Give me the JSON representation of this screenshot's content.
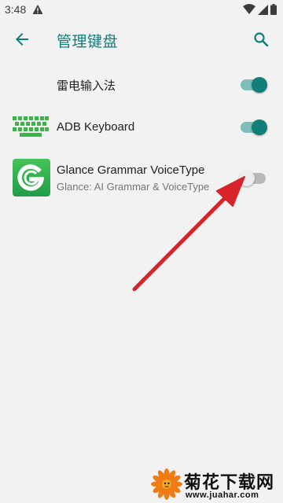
{
  "status_bar": {
    "time": "3:48",
    "icons": [
      "warning-icon",
      "wifi-icon",
      "signal-icon",
      "battery-icon"
    ]
  },
  "app_bar": {
    "title": "管理键盘",
    "accent_color": "#0f7f78",
    "icons": [
      "back-arrow-icon",
      "search-icon"
    ]
  },
  "keyboards": [
    {
      "title": "雷电输入法",
      "subtitle": "",
      "enabled": true,
      "icon": "none"
    },
    {
      "title": "ADB Keyboard",
      "subtitle": "",
      "enabled": true,
      "icon": "keyboard-icon",
      "icon_color": "#3ab54a"
    },
    {
      "title": "Glance Grammar VoiceType",
      "subtitle": "Glance: AI Grammar & VoiceType",
      "enabled": false,
      "icon": "glance-logo-icon",
      "icon_color": "#2fb34a"
    }
  ],
  "annotation": {
    "type": "red arrow pointing to toggle",
    "color": "#d8232a"
  },
  "watermark": {
    "name": "菊花下载网",
    "url": "www.juahar.com"
  }
}
